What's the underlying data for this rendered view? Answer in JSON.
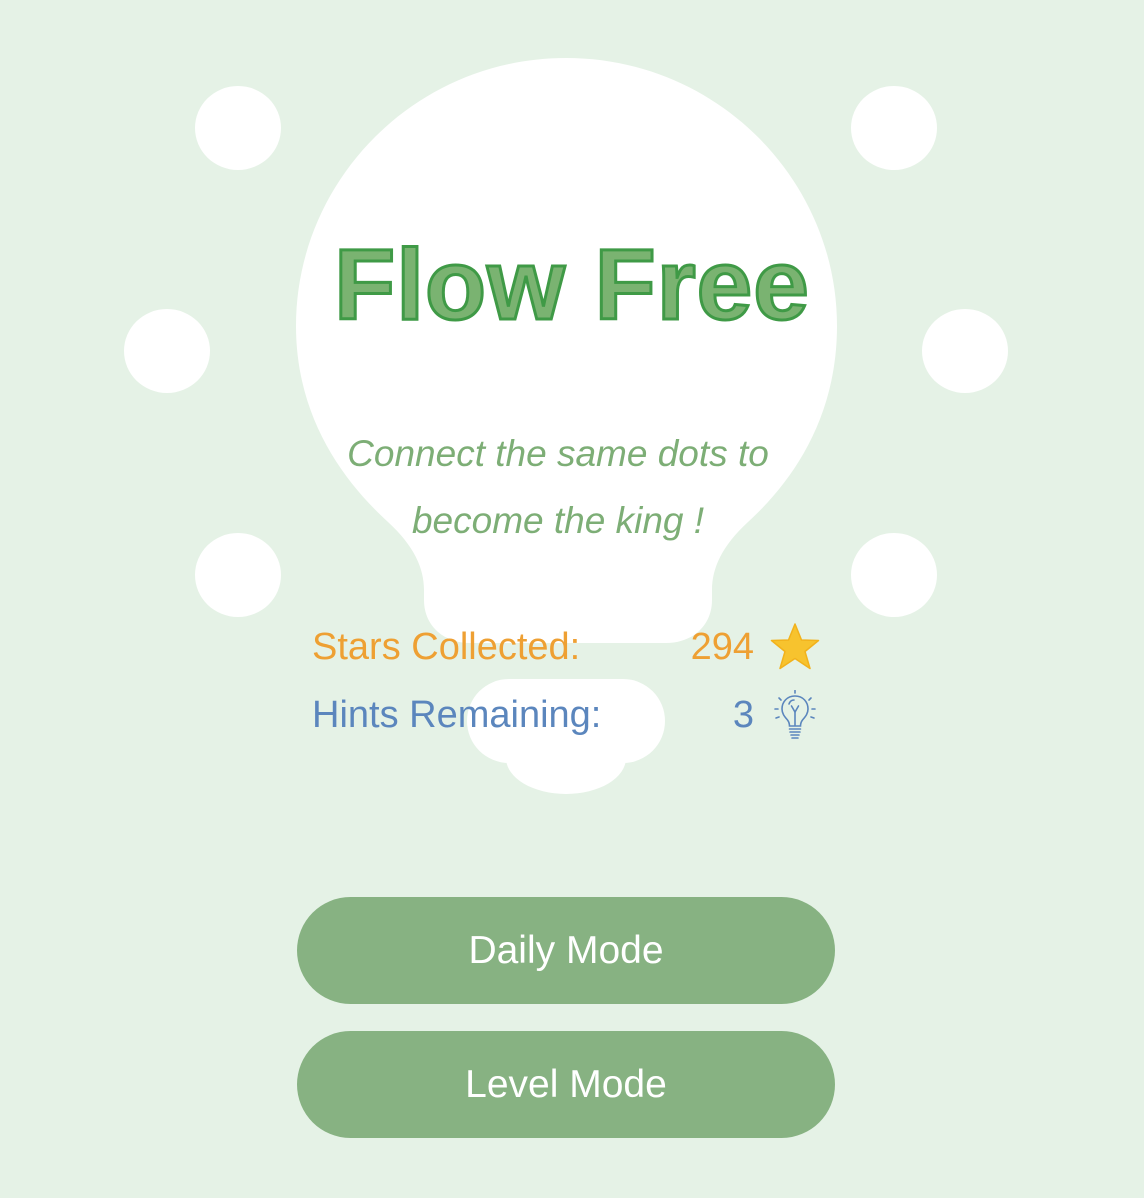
{
  "app": {
    "title": "Flow Free",
    "tagline_line1": "Connect the same dots to",
    "tagline_line2": "become the king !"
  },
  "stats": {
    "stars_label": "Stars Collected:",
    "stars_value": "294",
    "stars_icon": "star-icon",
    "hints_label": "Hints Remaining:",
    "hints_value": "3",
    "hints_icon": "lightbulb-icon"
  },
  "buttons": {
    "daily_label": "Daily Mode",
    "level_label": "Level Mode"
  },
  "colors": {
    "background": "#e5f2e6",
    "title_fill": "#7ab371",
    "title_stroke": "#3f9a46",
    "tagline": "#7dae76",
    "stars": "#eea033",
    "hints": "#5b86bd",
    "button": "#87b282",
    "button_text": "#ffffff",
    "star_fill": "#f7c32e"
  }
}
